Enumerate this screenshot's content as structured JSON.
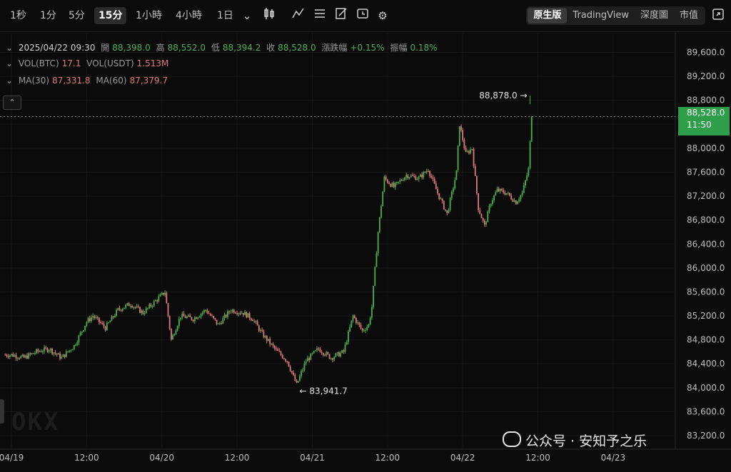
{
  "toolbar": {
    "timeframes": [
      "1秒",
      "1分",
      "5分",
      "15分",
      "1小時",
      "4小時",
      "1日"
    ],
    "active_timeframe": "15分",
    "views": [
      "原生版",
      "TradingView",
      "深度圖",
      "市值"
    ],
    "active_view": "原生版",
    "icons": [
      "chevron-down-icon",
      "candle-type-icon",
      "indicator-icon",
      "settings-list-icon",
      "drawing-icon",
      "timer-icon",
      "gear-icon",
      "fullscreen-icon"
    ]
  },
  "ohlc": {
    "date": "2025/04/22 09:30",
    "open_label": "開",
    "open": "88,398.0",
    "high_label": "高",
    "high": "88,552.0",
    "low_label": "低",
    "low": "88,394.2",
    "close_label": "收",
    "close": "88,528.0",
    "change_label": "漲跌幅",
    "change": "+0.15%",
    "amp_label": "振幅",
    "amp": "0.18%"
  },
  "volume": {
    "btc_label": "VOL(BTC)",
    "btc": "17.1",
    "usdt_label": "VOL(USDT)",
    "usdt": "1.513M"
  },
  "ma": {
    "ma30_label": "MA(30)",
    "ma30": "87,331.8",
    "ma60_label": "MA(60)",
    "ma60": "87,379.7"
  },
  "current_price": {
    "price": "88,528.0",
    "countdown": "11:50"
  },
  "markers": {
    "high": "88,878.0",
    "low": "83,941.7"
  },
  "watermark": {
    "text": "公众号 · 安知予之乐"
  },
  "logo": "OKX",
  "colors": {
    "up": "#4caf50",
    "down": "#e07a7a",
    "badge": "#2e9e4b"
  },
  "chart_data": {
    "type": "candlestick",
    "y_axis_ticks": [
      "89,600.0",
      "89,200.0",
      "88,800.0",
      "88,400.0",
      "88,000.0",
      "87,600.0",
      "87,200.0",
      "86,800.0",
      "86,400.0",
      "86,000.0",
      "85,600.0",
      "85,200.0",
      "84,800.0",
      "84,400.0",
      "84,000.0",
      "83,600.0",
      "83,200.0"
    ],
    "y_axis_values": [
      89600,
      89200,
      88800,
      88400,
      88000,
      87600,
      87200,
      86800,
      86400,
      86000,
      85600,
      85200,
      84800,
      84400,
      84000,
      83600,
      83200
    ],
    "ylim": [
      83000,
      89900
    ],
    "x_axis_ticks": [
      "04/19",
      "12:00",
      "04/20",
      "12:00",
      "04/21",
      "12:00",
      "04/22",
      "12:00",
      "04/23"
    ],
    "x_axis_hours": [
      0,
      12,
      24,
      36,
      48,
      60,
      72,
      84,
      96
    ],
    "xlim_hours": [
      -1,
      96.5
    ],
    "current_price_value": 88528,
    "high_marker_value": 88878,
    "low_marker_value": 83941.7,
    "price_path": [
      [
        0,
        84550
      ],
      [
        2,
        84500
      ],
      [
        4,
        84600
      ],
      [
        6,
        84650
      ],
      [
        8,
        84500
      ],
      [
        10,
        84700
      ],
      [
        12,
        85100
      ],
      [
        13,
        85200
      ],
      [
        15,
        85000
      ],
      [
        17,
        85300
      ],
      [
        19,
        85400
      ],
      [
        21,
        85250
      ],
      [
        23,
        85450
      ],
      [
        24.5,
        85600
      ],
      [
        25.5,
        84800
      ],
      [
        27,
        85200
      ],
      [
        29,
        85150
      ],
      [
        31,
        85300
      ],
      [
        33,
        85050
      ],
      [
        35,
        85300
      ],
      [
        37,
        85250
      ],
      [
        38.5,
        85150
      ],
      [
        40,
        84900
      ],
      [
        42,
        84650
      ],
      [
        44,
        84450
      ],
      [
        45.5,
        84050
      ],
      [
        47,
        84450
      ],
      [
        49,
        84650
      ],
      [
        51,
        84500
      ],
      [
        53,
        84600
      ],
      [
        54.5,
        85200
      ],
      [
        56,
        84950
      ],
      [
        57,
        85050
      ],
      [
        57.5,
        85350
      ],
      [
        58.5,
        86600
      ],
      [
        59.5,
        87500
      ],
      [
        61,
        87350
      ],
      [
        63,
        87550
      ],
      [
        65,
        87500
      ],
      [
        66.5,
        87650
      ],
      [
        68,
        87250
      ],
      [
        69.5,
        86900
      ],
      [
        70.5,
        87350
      ],
      [
        71,
        87600
      ],
      [
        71.5,
        88400
      ],
      [
        72.5,
        87900
      ],
      [
        73.5,
        88000
      ],
      [
        74.5,
        87000
      ],
      [
        75.5,
        86700
      ],
      [
        76.5,
        87100
      ],
      [
        77.5,
        87300
      ],
      [
        79,
        87250
      ],
      [
        80.5,
        87100
      ],
      [
        81.5,
        87250
      ],
      [
        82.5,
        87650
      ],
      [
        83,
        88528
      ]
    ]
  }
}
